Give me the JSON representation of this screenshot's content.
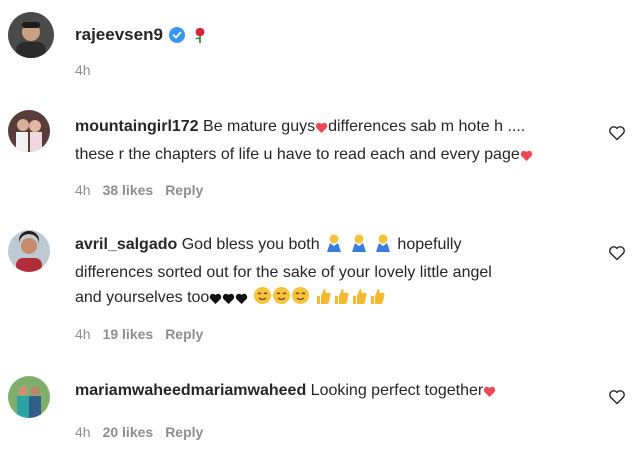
{
  "post": {
    "username": "rajeevsen9",
    "time": "4h",
    "icons": [
      "verified-badge-icon",
      "rose-emoji-icon"
    ]
  },
  "comments": [
    {
      "username": "mountaingirl172",
      "line1": "Be mature guys",
      "line1b": "differences sab m hote h ....",
      "line2": "these r the chapters of life u have to read each and every page",
      "time": "4h",
      "likes": "38 likes",
      "reply": "Reply"
    },
    {
      "username": "avril_salgado",
      "line1": "God bless you both",
      "line1b": "hopefully",
      "line2": "differences sorted out for the sake of your lovely little angel",
      "line3": "and yourselves too",
      "time": "4h",
      "likes": "19 likes",
      "reply": "Reply"
    },
    {
      "username": "mariamwaheedmariamwaheed",
      "line1": "Looking perfect together",
      "time": "4h",
      "likes": "20 likes",
      "reply": "Reply"
    }
  ],
  "colors": {
    "text": "#262626",
    "secondary": "#8e8e8e",
    "verified": "#3897f0",
    "heart": "#ed4956"
  }
}
